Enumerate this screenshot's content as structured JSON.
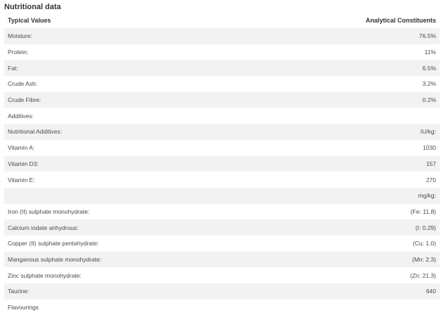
{
  "title": "Nutritional data",
  "headers": {
    "name": "Typical Values",
    "value": "Analytical Constituents"
  },
  "rows": [
    {
      "name": "Moisture:",
      "value": "76.5%"
    },
    {
      "name": "Protein:",
      "value": "11%"
    },
    {
      "name": "Fat:",
      "value": "6.5%"
    },
    {
      "name": "Crude Ash:",
      "value": "3.2%"
    },
    {
      "name": "Crude Fibre:",
      "value": "0.2%"
    },
    {
      "name": "Additives:",
      "value": ""
    },
    {
      "name": "Nutritional Additives:",
      "value": "IU/kg:"
    },
    {
      "name": "Vitamin A:",
      "value": "1030"
    },
    {
      "name": "Vitamin D3:",
      "value": "157"
    },
    {
      "name": "Vitamin E:",
      "value": "270"
    },
    {
      "name": "",
      "value": "mg/kg:"
    },
    {
      "name": "Iron (II) sulphate monohydrate:",
      "value": "(Fe: 11.8)"
    },
    {
      "name": "Calcium iodate anhydrous:",
      "value": "(I: 0.29)"
    },
    {
      "name": "Copper (II) sulphate pentahydrate:",
      "value": "(Cu: 1.0)"
    },
    {
      "name": "Manganous sulphate monohydrate:",
      "value": "(Mn: 2.3)"
    },
    {
      "name": "Zinc sulphate monohydrate:",
      "value": "(Zn: 21.3)"
    },
    {
      "name": "Taurine:",
      "value": "640"
    },
    {
      "name": "Flavourings",
      "value": ""
    }
  ]
}
